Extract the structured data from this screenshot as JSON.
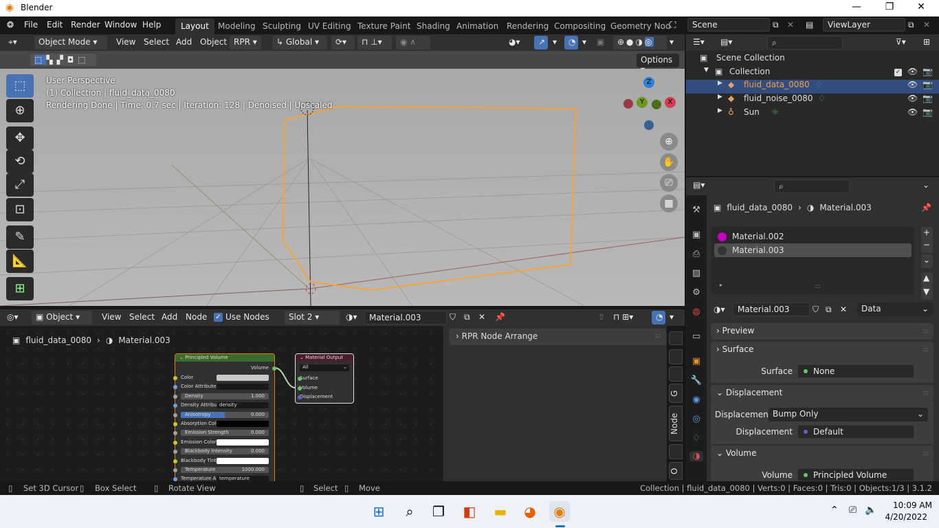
{
  "window": {
    "title": "Blender",
    "controls": [
      "—",
      "❐",
      "✕"
    ]
  },
  "menus": [
    "File",
    "Edit",
    "Render",
    "Window",
    "Help"
  ],
  "workspaces": [
    "Layout",
    "Modeling",
    "Sculpting",
    "UV Editing",
    "Texture Paint",
    "Shading",
    "Animation",
    "Rendering",
    "Compositing",
    "Geometry Nod"
  ],
  "active_workspace": "Layout",
  "scene": "Scene",
  "view_layer": "ViewLayer",
  "viewport_header": {
    "mode": "Object Mode",
    "menus": [
      "View",
      "Select",
      "Add",
      "Object"
    ],
    "engine": "RPR",
    "transform": "Global",
    "options": "Options"
  },
  "viewport": {
    "perspective": "User Perspective",
    "collection": "(1) Collection | fluid_data_0080",
    "render_status": "Rendering Done | Time: 0.7 sec | Iteration: 128 | Denoised | Upscaled",
    "gizmo": {
      "z": "Z",
      "y": "Y",
      "x": "X"
    }
  },
  "node_header": {
    "type": "Object",
    "menus": [
      "View",
      "Select",
      "Add",
      "Node"
    ],
    "use_nodes": "Use Nodes",
    "use_nodes_checked": true,
    "slot": "Slot 2",
    "material": "Material.003"
  },
  "node_breadcrumb": {
    "object": "fluid_data_0080",
    "material": "Material.003"
  },
  "nodes": {
    "principled": {
      "title": "Principled Volume",
      "output": "Volume",
      "inputs": [
        {
          "label": "Color",
          "kind": "color",
          "color": "#c8c8c8"
        },
        {
          "label": "Color Attribute",
          "kind": "text",
          "value": ""
        },
        {
          "label": "Density",
          "kind": "slider",
          "value": "1.000"
        },
        {
          "label": "Density Attribute",
          "kind": "text",
          "value": "density"
        },
        {
          "label": "Anisotropy",
          "kind": "slider",
          "value": "0.000",
          "fill": 0.5
        },
        {
          "label": "Absorption Color",
          "kind": "color",
          "color": "#000000"
        },
        {
          "label": "Emission Strength",
          "kind": "slider",
          "value": "0.000"
        },
        {
          "label": "Emission Color",
          "kind": "color",
          "color": "#ffffff"
        },
        {
          "label": "Blackbody Intensity",
          "kind": "slider",
          "value": "0.000"
        },
        {
          "label": "Blackbody Tint",
          "kind": "color",
          "color": "#ffffff"
        },
        {
          "label": "Temperature",
          "kind": "slider",
          "value": "1000.000"
        },
        {
          "label": "Temperature A",
          "kind": "text",
          "value": "temperature"
        }
      ]
    },
    "output": {
      "title": "Material Output",
      "target": "All",
      "inputs": [
        "Surface",
        "Volume",
        "Displacement"
      ]
    }
  },
  "node_sidebar": {
    "panel": "RPR Node Arrange",
    "tabs": [
      "G",
      "Node",
      "O"
    ]
  },
  "outliner": {
    "root": "Scene Collection",
    "collection": "Collection",
    "items": [
      {
        "name": "fluid_data_0080",
        "selected": true
      },
      {
        "name": "fluid_noise_0080",
        "selected": false
      },
      {
        "name": "Sun",
        "selected": false
      }
    ]
  },
  "properties": {
    "object": "fluid_data_0080",
    "material": "Material.003",
    "slots": [
      "Material.002",
      "Material.003"
    ],
    "material_field": "Material.003",
    "link": "Data",
    "panels": {
      "preview": "Preview",
      "surface": "Surface",
      "displacement": "Displacement",
      "volume": "Volume"
    },
    "surface_label": "Surface",
    "surface_value": "None",
    "disp_method_label": "Displacemen...",
    "disp_method": "Bump Only",
    "disp_label": "Displacement",
    "disp_value": "Default",
    "volume_label": "Volume",
    "volume_value": "Principled Volume"
  },
  "status": {
    "left": [
      {
        "label": "Set 3D Cursor"
      },
      {
        "label": "Box Select"
      },
      {
        "label": "Rotate View"
      },
      {
        "label": "Select"
      },
      {
        "label": "Move"
      }
    ],
    "right": "Collection | fluid_data_0080 | Verts:0 | Faces:0 | Tris:0 | Objects:1/3 | 3.1.2"
  },
  "taskbar": {
    "time": "10:09 AM",
    "date": "4/20/2022"
  }
}
